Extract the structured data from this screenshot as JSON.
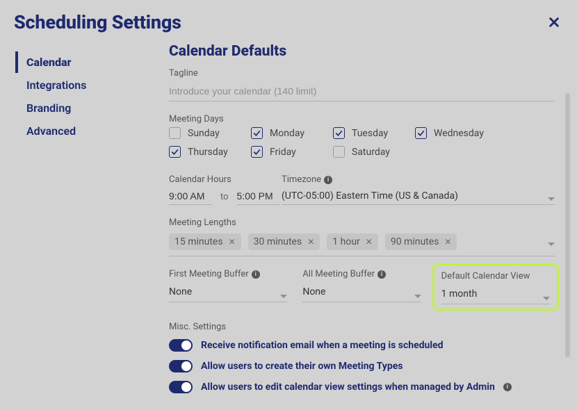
{
  "modal": {
    "title": "Scheduling Settings"
  },
  "sidebar": {
    "items": [
      {
        "label": "Calendar",
        "active": true
      },
      {
        "label": "Integrations",
        "active": false
      },
      {
        "label": "Branding",
        "active": false
      },
      {
        "label": "Advanced",
        "active": false
      }
    ]
  },
  "section": {
    "title": "Calendar Defaults",
    "tagline_label": "Tagline",
    "tagline_placeholder": "Introduce your calendar (140 limit)",
    "meeting_days_label": "Meeting Days",
    "days": [
      {
        "label": "Sunday",
        "checked": false
      },
      {
        "label": "Monday",
        "checked": true
      },
      {
        "label": "Tuesday",
        "checked": true
      },
      {
        "label": "Wednesday",
        "checked": true
      },
      {
        "label": "Thursday",
        "checked": true
      },
      {
        "label": "Friday",
        "checked": true
      },
      {
        "label": "Saturday",
        "checked": false
      }
    ],
    "calendar_hours_label": "Calendar Hours",
    "hours_from": "9:00 AM",
    "hours_to_label": "to",
    "hours_to": "5:00 PM",
    "timezone_label": "Timezone",
    "timezone_value": "(UTC-05:00) Eastern Time (US & Canada)",
    "meeting_lengths_label": "Meeting Lengths",
    "lengths": [
      "15 minutes",
      "30 minutes",
      "1 hour",
      "90 minutes"
    ],
    "first_buffer_label": "First Meeting Buffer",
    "first_buffer_value": "None",
    "all_buffer_label": "All Meeting Buffer",
    "all_buffer_value": "None",
    "default_view_label": "Default Calendar View",
    "default_view_value": "1 month",
    "misc_label": "Misc. Settings",
    "misc": [
      {
        "label": "Receive notification email when a meeting is scheduled",
        "on": true
      },
      {
        "label": "Allow users to create their own Meeting Types",
        "on": true
      },
      {
        "label": "Allow users to edit calendar view settings when managed by Admin",
        "on": true
      }
    ]
  }
}
